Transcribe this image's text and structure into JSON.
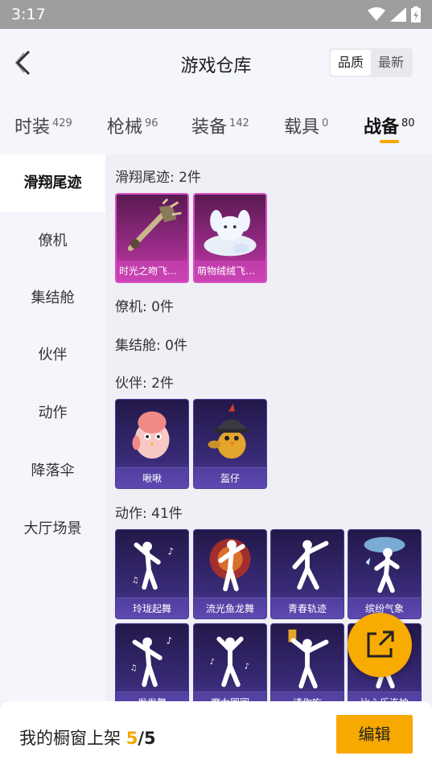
{
  "status": {
    "time": "3:17"
  },
  "header": {
    "title": "游戏仓库",
    "sort": [
      "品质",
      "最新"
    ]
  },
  "tabs": [
    {
      "label": "时装",
      "count": "429"
    },
    {
      "label": "枪械",
      "count": "96"
    },
    {
      "label": "装备",
      "count": "142"
    },
    {
      "label": "载具",
      "count": "0"
    },
    {
      "label": "战备",
      "count": "80"
    }
  ],
  "sidebar": [
    "滑翔尾迹",
    "僚机",
    "集结舱",
    "伙伴",
    "动作",
    "降落伞",
    "大厅场景"
  ],
  "sections": {
    "glide": {
      "title": "滑翔尾迹: 2件",
      "items": [
        "时光之吻飞行...",
        "萌物绒绒飞行..."
      ]
    },
    "wingman": {
      "title": "僚机: 0件"
    },
    "pod": {
      "title": "集结舱: 0件"
    },
    "partner": {
      "title": "伙伴: 2件",
      "items": [
        "啾啾",
        "盔仔"
      ]
    },
    "emote": {
      "title": "动作: 41件",
      "items": [
        "玲珑起舞",
        "流光鱼龙舞",
        "青春轨迹",
        "缤纷气象",
        "发发舞",
        "魔力圆圈",
        "请你吃",
        "比心乐连拍"
      ]
    }
  },
  "footer": {
    "label": "我的橱窗上架",
    "current": "5",
    "sep": "/",
    "max": "5",
    "edit": "编辑"
  }
}
